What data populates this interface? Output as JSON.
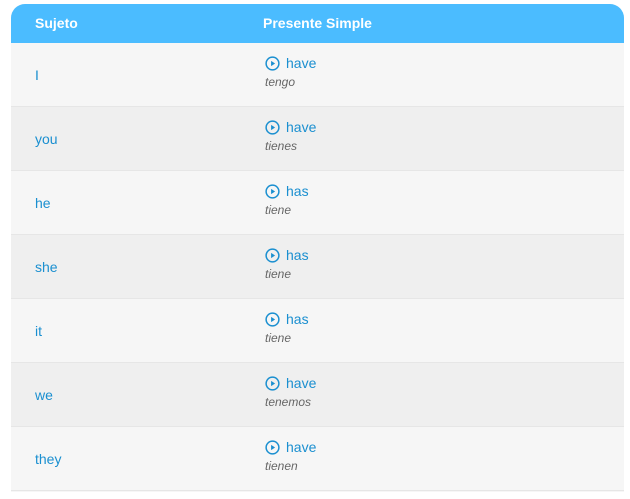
{
  "table": {
    "headers": {
      "subject": "Sujeto",
      "tense": "Presente Simple"
    },
    "rows": [
      {
        "subject": "I",
        "verb": "have",
        "translation": "tengo"
      },
      {
        "subject": "you",
        "verb": "have",
        "translation": "tienes"
      },
      {
        "subject": "he",
        "verb": "has",
        "translation": "tiene"
      },
      {
        "subject": "she",
        "verb": "has",
        "translation": "tiene"
      },
      {
        "subject": "it",
        "verb": "has",
        "translation": "tiene"
      },
      {
        "subject": "we",
        "verb": "have",
        "translation": "tenemos"
      },
      {
        "subject": "they",
        "verb": "have",
        "translation": "tienen"
      }
    ]
  },
  "colors": {
    "header_bg": "#4bbcff",
    "accent": "#1a8fd0",
    "translation_text": "#666666",
    "row_odd": "#f6f6f6",
    "row_even": "#efefef"
  },
  "icons": {
    "play": "play-circle-icon"
  }
}
